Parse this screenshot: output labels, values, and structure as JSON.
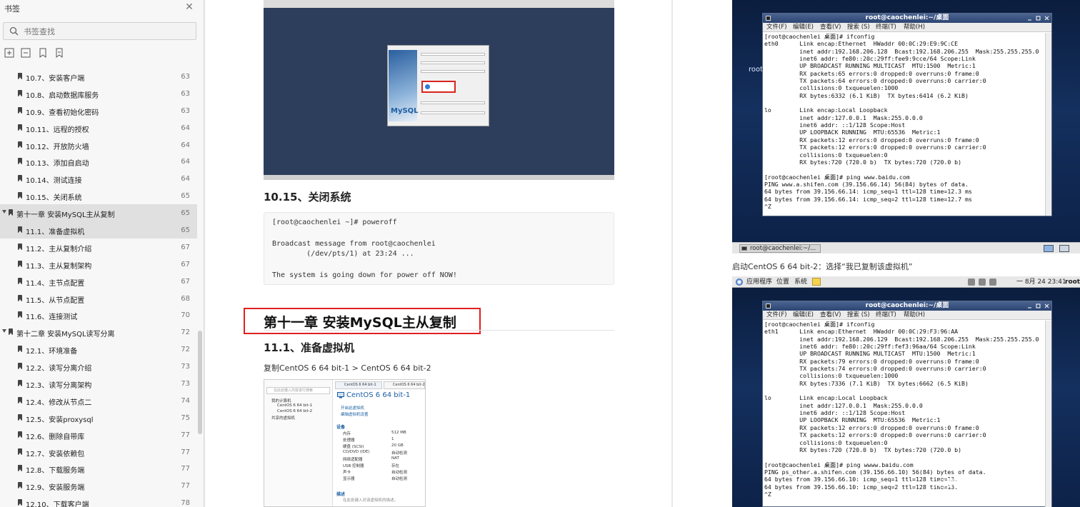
{
  "sidebar": {
    "title": "书签",
    "search_placeholder": "书签查找",
    "items": [
      {
        "label": "10.7、安装客户端",
        "page": "63",
        "level": 2
      },
      {
        "label": "10.8、启动数据库服务",
        "page": "63",
        "level": 2
      },
      {
        "label": "10.9、查看初始化密码",
        "page": "63",
        "level": 2
      },
      {
        "label": "10.11、远程的授权",
        "page": "64",
        "level": 2
      },
      {
        "label": "10.12、开放防火墙",
        "page": "64",
        "level": 2
      },
      {
        "label": "10.13、添加自启动",
        "page": "64",
        "level": 2
      },
      {
        "label": "10.14、测试连接",
        "page": "64",
        "level": 2
      },
      {
        "label": "10.15、关闭系统",
        "page": "65",
        "level": 2
      },
      {
        "label": "第十一章 安装MySQL主从复制",
        "page": "65",
        "level": 1
      },
      {
        "label": "11.1、准备虚拟机",
        "page": "65",
        "level": 2
      },
      {
        "label": "11.2、主从复制介绍",
        "page": "67",
        "level": 2
      },
      {
        "label": "11.3、主从复制架构",
        "page": "67",
        "level": 2
      },
      {
        "label": "11.4、主节点配置",
        "page": "67",
        "level": 2
      },
      {
        "label": "11.5、从节点配置",
        "page": "68",
        "level": 2
      },
      {
        "label": "11.6、连接测试",
        "page": "70",
        "level": 2
      },
      {
        "label": "第十二章 安装MySQL读写分离",
        "page": "72",
        "level": 1
      },
      {
        "label": "12.1、环境准备",
        "page": "72",
        "level": 2
      },
      {
        "label": "12.2、读写分离介绍",
        "page": "73",
        "level": 2
      },
      {
        "label": "12.3、读写分离架构",
        "page": "73",
        "level": 2
      },
      {
        "label": "12.4、修改从节点二",
        "page": "74",
        "level": 2
      },
      {
        "label": "12.5、安装proxysql",
        "page": "75",
        "level": 2
      },
      {
        "label": "12.6、删除自带库",
        "page": "77",
        "level": 2
      },
      {
        "label": "12.7、安装依赖包",
        "page": "77",
        "level": 2
      },
      {
        "label": "12.8、下载服务端",
        "page": "77",
        "level": 2
      },
      {
        "label": "12.9、安装服务端",
        "page": "77",
        "level": 2
      },
      {
        "label": "12.10、下载客户端",
        "page": "78",
        "level": 2
      }
    ]
  },
  "page1": {
    "section_1015": "10.15、关闭系统",
    "code_lines": [
      "[root@caochenlei ~]# poweroff",
      "",
      "Broadcast message from root@caochenlei",
      "        (/dev/pts/1) at 23:24 ...",
      "",
      "The system is going down for power off NOW!"
    ],
    "chapter_title": "第十一章 安装MySQL主从复制",
    "section_111": "11.1、准备虚拟机",
    "copy_text": "复制CentOS 6 64 bit-1 > CentOS 6 64 bit-2",
    "mysql_dialog": {
      "brand": "MySQL"
    },
    "vm_panel": {
      "search": "在此处键入内容进行搜索",
      "tree": [
        "我的计算机",
        "CentOS 6 64 bit-1",
        "CentOS 6 64 bit-2",
        "共享的虚拟机"
      ],
      "tabs": [
        "CentOS 6 64 bit-1",
        "CentOS 6 64 bit-2"
      ],
      "title": "CentOS 6 64 bit-1",
      "actions": [
        "开启此虚拟机",
        "编辑虚拟机设置"
      ],
      "devices_header": "设备",
      "devices": [
        {
          "name": "内存",
          "value": "512 MB"
        },
        {
          "name": "处理器",
          "value": "1"
        },
        {
          "name": "硬盘 (SCSI)",
          "value": "20 GB"
        },
        {
          "name": "CD/DVD (IDE)",
          "value": "自动检测"
        },
        {
          "name": "网络适配器",
          "value": "NAT"
        },
        {
          "name": "USB 控制器",
          "value": "存在"
        },
        {
          "name": "声卡",
          "value": "自动检测"
        },
        {
          "name": "显示器",
          "value": "自动检测"
        }
      ],
      "desc_header": "描述",
      "desc_text": "在此处键入对该虚拟机的描述。"
    }
  },
  "page2": {
    "desktop_label": "root",
    "terminal1": {
      "title": "root@caochenlei:~/桌面",
      "menu": [
        "文件(F)",
        "编辑(E)",
        "查看(V)",
        "搜索 (S)",
        "终端(T)",
        "帮助(H)"
      ],
      "lines": [
        "[root@caochenlei 桌面]# ifconfig",
        "eth0      Link encap:Ethernet  HWaddr 00:0C:29:E9:9C:CE",
        "          inet addr:192.168.206.128  Bcast:192.168.206.255  Mask:255.255.255.0",
        "          inet6 addr: fe80::20c:29ff:fee9:9cce/64 Scope:Link",
        "          UP BROADCAST RUNNING MULTICAST  MTU:1500  Metric:1",
        "          RX packets:65 errors:0 dropped:0 overruns:0 frame:0",
        "          TX packets:64 errors:0 dropped:0 overruns:0 carrier:0",
        "          collisions:0 txqueuelen:1000",
        "          RX bytes:6332 (6.1 KiB)  TX bytes:6414 (6.2 KiB)",
        "",
        "lo        Link encap:Local Loopback",
        "          inet addr:127.0.0.1  Mask:255.0.0.0",
        "          inet6 addr: ::1/128 Scope:Host",
        "          UP LOOPBACK RUNNING  MTU:65536  Metric:1",
        "          RX packets:12 errors:0 dropped:0 overruns:0 frame:0",
        "          TX packets:12 errors:0 dropped:0 overruns:0 carrier:0",
        "          collisions:0 txqueuelen:0",
        "          RX bytes:720 (720.0 b)  TX bytes:720 (720.0 b)",
        "",
        "[root@caochenlei 桌面]# ping www.baidu.com",
        "PING www.a.shifen.com (39.156.66.14) 56(84) bytes of data.",
        "64 bytes from 39.156.66.14: icmp_seq=1 ttl=128 time=12.3 ms",
        "64 bytes from 39.156.66.14: icmp_seq=2 ttl=128 time=12.7 ms",
        "^Z"
      ]
    },
    "taskbar_item": "root@caochenlei:~/...",
    "caption": "启动CentOS 6 64 bit-2：选择“我已复制该虚拟机”",
    "panel": {
      "apps": "应用程序",
      "places": "位置",
      "system": "系统",
      "clock": "一 8月 24 23:41",
      "user": "root"
    },
    "terminal2": {
      "title": "root@caochenlei:~/桌面",
      "menu": [
        "文件(F)",
        "编辑(E)",
        "查看(V)",
        "搜索 (S)",
        "终端(T)",
        "帮助(H)"
      ],
      "lines": [
        "[root@caochenlei 桌面]# ifconfig",
        "eth1      Link encap:Ethernet  HWaddr 00:0C:29:F3:96:AA",
        "          inet addr:192.168.206.129  Bcast:192.168.206.255  Mask:255.255.255.0",
        "          inet6 addr: fe80::20c:29ff:fef3:96aa/64 Scope:Link",
        "          UP BROADCAST RUNNING MULTICAST  MTU:1500  Metric:1",
        "          RX packets:79 errors:0 dropped:0 overruns:0 frame:0",
        "          TX packets:74 errors:0 dropped:0 overruns:0 carrier:0",
        "          collisions:0 txqueuelen:1000",
        "          RX bytes:7336 (7.1 KiB)  TX bytes:6662 (6.5 KiB)",
        "",
        "lo        Link encap:Local Loopback",
        "          inet addr:127.0.0.1  Mask:255.0.0.0",
        "          inet6 addr: ::1/128 Scope:Host",
        "          UP LOOPBACK RUNNING  MTU:65536  Metric:1",
        "          RX packets:12 errors:0 dropped:0 overruns:0 frame:0",
        "          TX packets:12 errors:0 dropped:0 overruns:0 carrier:0",
        "          collisions:0 txqueuelen:0",
        "          RX bytes:720 (720.0 b)  TX bytes:720 (720.0 b)",
        "",
        "[root@caochenlei 桌面]# ping wwww.baidu.com",
        "PING ps_other.a.shifen.com (39.156.66.10) 56(84) bytes of data.",
        "64 bytes from 39.156.66.10: icmp_seq=1 ttl=128 time=13.",
        "64 bytes from 39.156.66.10: icmp_seq=2 ttl=128 time=13.",
        "^Z"
      ]
    },
    "watermark": "@稀土掘金技术社区"
  }
}
